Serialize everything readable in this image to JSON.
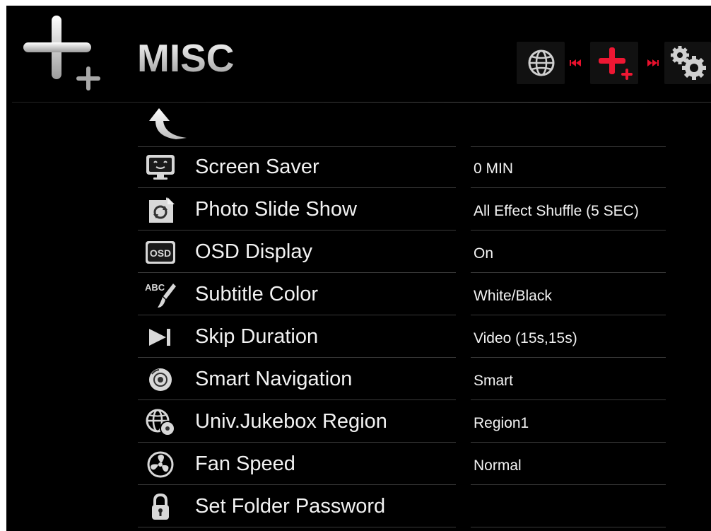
{
  "header": {
    "title": "MISC",
    "section_icon": "plus-plus-icon",
    "nav": {
      "left_icon": "globe-icon",
      "prev_icon": "rewind-icon",
      "current_icon": "plus-plus-icon",
      "next_icon": "fast-forward-icon",
      "right_icon": "gears-icon",
      "accent_color": "#e8112d"
    }
  },
  "back": {
    "icon": "back-arrow-icon"
  },
  "settings": [
    {
      "label": "Screen Saver",
      "value": "0 MIN",
      "icon": "screen-saver-icon"
    },
    {
      "label": "Photo Slide Show",
      "value": "All Effect Shuffle (5 SEC)",
      "icon": "photo-slideshow-icon"
    },
    {
      "label": "OSD Display",
      "value": "On",
      "icon": "osd-icon"
    },
    {
      "label": "Subtitle Color",
      "value": "White/Black",
      "icon": "subtitle-brush-icon"
    },
    {
      "label": "Skip Duration",
      "value": "Video (15s,15s)",
      "icon": "skip-icon"
    },
    {
      "label": "Smart Navigation",
      "value": "Smart",
      "icon": "disc-icon"
    },
    {
      "label": "Univ.Jukebox Region",
      "value": "Region1",
      "icon": "globe-disc-icon"
    },
    {
      "label": "Fan Speed",
      "value": "Normal",
      "icon": "fan-icon"
    },
    {
      "label": "Set Folder Password",
      "value": "",
      "icon": "lock-icon"
    }
  ]
}
